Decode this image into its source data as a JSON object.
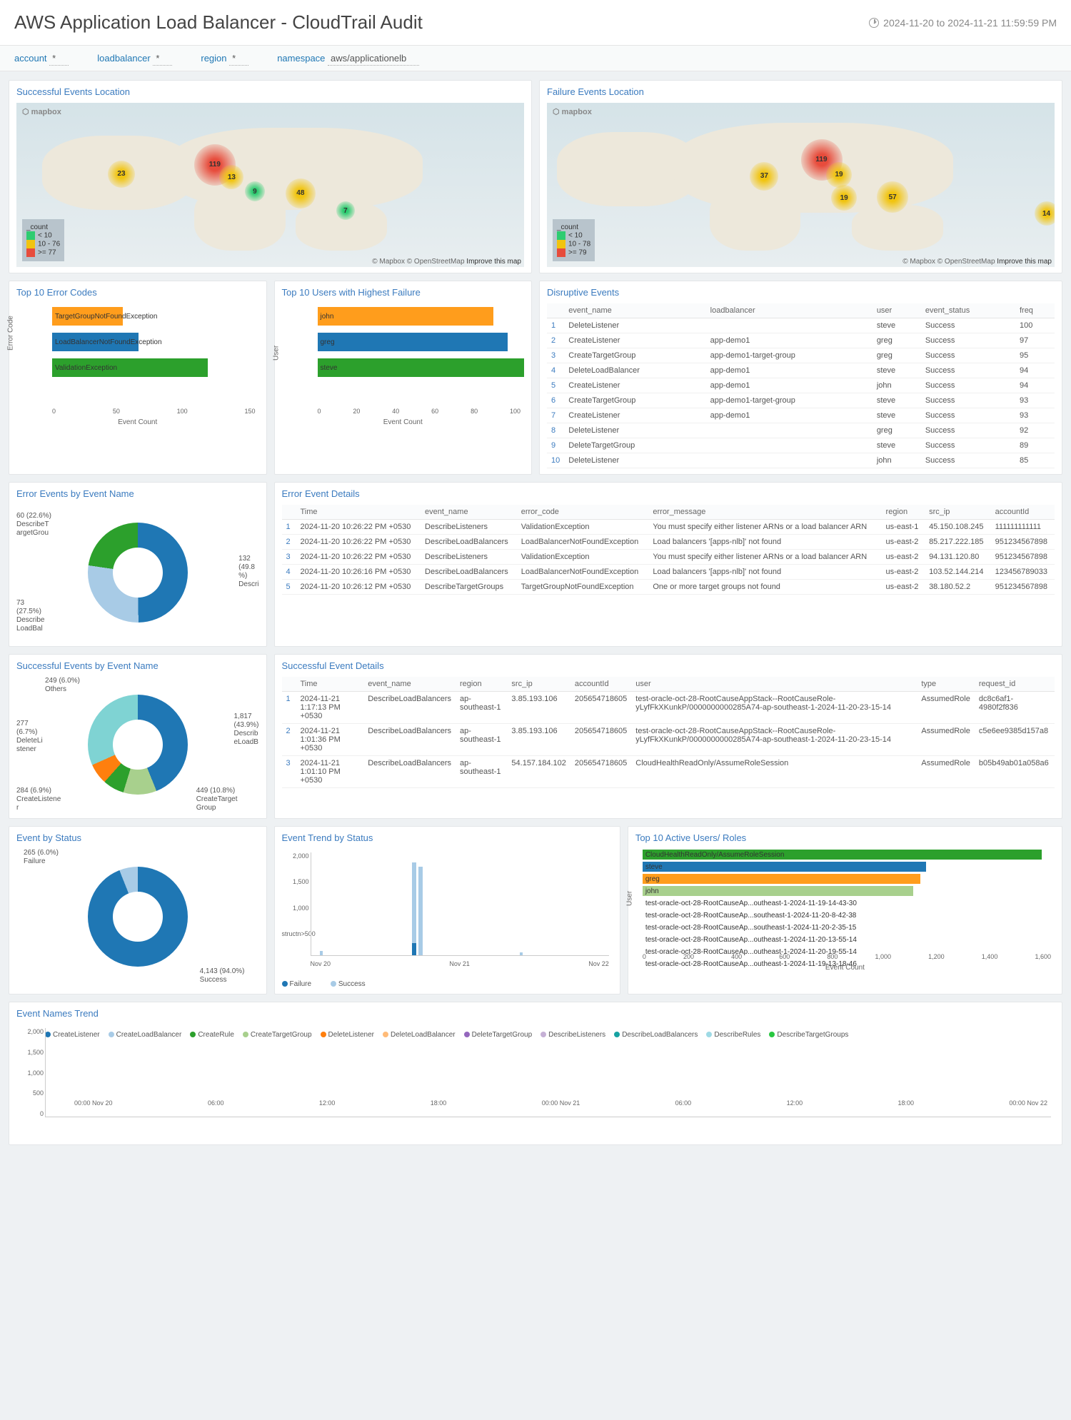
{
  "header": {
    "title": "AWS Application Load Balancer - CloudTrail Audit",
    "range": "2024-11-20 to 2024-11-21 11:59:59 PM"
  },
  "filters": [
    {
      "label": "account",
      "value": "*"
    },
    {
      "label": "loadbalancer",
      "value": "*"
    },
    {
      "label": "region",
      "value": "*"
    },
    {
      "label": "namespace",
      "value": "aws/applicationelb"
    }
  ],
  "maps": {
    "success": {
      "title": "Successful Events Location",
      "legend": {
        "title": "_count",
        "buckets": [
          "< 10",
          "10 - 76",
          ">= 77"
        ]
      },
      "attribution": "© Mapbox © OpenStreetMap",
      "improve": "Improve this map",
      "bubbles": [
        {
          "v": "119",
          "c": "red",
          "x": 35,
          "y": 25,
          "s": 58
        },
        {
          "v": "23",
          "c": "yel",
          "x": 18,
          "y": 35,
          "s": 38
        },
        {
          "v": "13",
          "c": "yel",
          "x": 40,
          "y": 38,
          "s": 34
        },
        {
          "v": "48",
          "c": "yel",
          "x": 53,
          "y": 46,
          "s": 42
        },
        {
          "v": "9",
          "c": "grn",
          "x": 45,
          "y": 48,
          "s": 28
        },
        {
          "v": "7",
          "c": "grn",
          "x": 63,
          "y": 60,
          "s": 26
        }
      ]
    },
    "failure": {
      "title": "Failure Events Location",
      "legend": {
        "title": "_count",
        "buckets": [
          "< 10",
          "10 - 78",
          ">= 79"
        ]
      },
      "attribution": "© Mapbox © OpenStreetMap",
      "improve": "Improve this map",
      "bubbles": [
        {
          "v": "119",
          "c": "red",
          "x": 50,
          "y": 22,
          "s": 58
        },
        {
          "v": "37",
          "c": "yel",
          "x": 40,
          "y": 36,
          "s": 40
        },
        {
          "v": "19",
          "c": "yel",
          "x": 55,
          "y": 36,
          "s": 36
        },
        {
          "v": "19",
          "c": "yel",
          "x": 56,
          "y": 50,
          "s": 36
        },
        {
          "v": "57",
          "c": "yel",
          "x": 65,
          "y": 48,
          "s": 44
        },
        {
          "v": "14",
          "c": "yel",
          "x": 96,
          "y": 60,
          "s": 34
        }
      ]
    }
  },
  "chart_data": {
    "top_error_codes": {
      "type": "bar",
      "title": "Top 10 Error Codes",
      "xlabel": "Event Count",
      "ylabel": "Error Code",
      "ylim": [
        0,
        175
      ],
      "categories": [
        "ValidationException",
        "LoadBalancerNotFoundException",
        "TargetGroupNotFoundException"
      ],
      "values": [
        132,
        73,
        60
      ],
      "colors": [
        "#2ca02c",
        "#1f77b4",
        "#ff9d1c"
      ]
    },
    "top_failure_users": {
      "type": "bar",
      "title": "Top 10 Users with Highest Failure",
      "xlabel": "Event Count",
      "ylabel": "User",
      "ylim": [
        0,
        100
      ],
      "categories": [
        "steve",
        "greg",
        "john"
      ],
      "values": [
        100,
        92,
        85
      ],
      "colors": [
        "#2ca02c",
        "#1f77b4",
        "#ff9d1c"
      ]
    },
    "error_events_by_name": {
      "type": "pie",
      "title": "Error Events by Event Name",
      "series": [
        {
          "name": "Descri",
          "value": 132,
          "pct": 49.8,
          "color": "#1f77b4"
        },
        {
          "name": "DescribeLoadBal",
          "value": 73,
          "pct": 27.5,
          "color": "#a8cbe6"
        },
        {
          "name": "DescribeTargetGrou",
          "value": 60,
          "pct": 22.6,
          "color": "#2ca02c"
        }
      ]
    },
    "success_events_by_name": {
      "type": "pie",
      "title": "Successful Events by Event Name",
      "series": [
        {
          "name": "DescribeLoadB",
          "value": 1817,
          "pct": 43.9,
          "color": "#1f77b4"
        },
        {
          "name": "CreateTargetGroup",
          "value": 449,
          "pct": 10.8,
          "color": "#a8d08d"
        },
        {
          "name": "CreateListener",
          "value": 284,
          "pct": 6.9,
          "color": "#2ca02c"
        },
        {
          "name": "DeleteListener",
          "value": 277,
          "pct": 6.7,
          "color": "#ff7f0e"
        },
        {
          "name": "Others",
          "value": 249,
          "pct": 6.0,
          "color": "#7fd3d3"
        }
      ]
    },
    "event_by_status": {
      "type": "pie",
      "title": "Event by Status",
      "series": [
        {
          "name": "Success",
          "value": 4143,
          "pct": 94.0,
          "color": "#1f77b4"
        },
        {
          "name": "Failure",
          "value": 265,
          "pct": 6.0,
          "color": "#a8cbe6"
        }
      ]
    },
    "event_trend": {
      "type": "line",
      "title": "Event Trend by Status",
      "xlabel": "",
      "ylabel": "",
      "ylim": [
        0,
        2000
      ],
      "x": [
        "Nov 20",
        "Nov 21",
        "Nov 22"
      ],
      "series": [
        {
          "name": "Failure",
          "color": "#1f77b4"
        },
        {
          "name": "Success",
          "color": "#a8cbe6"
        }
      ],
      "peak": {
        "x_frac": 0.35,
        "success": 1800,
        "failure": 250
      }
    },
    "active_users": {
      "type": "bar",
      "title": "Top 10 Active Users/ Roles",
      "xlabel": "Event Count",
      "ylabel": "User",
      "ylim": [
        0,
        1600
      ],
      "categories": [
        "CloudHealthReadOnly/AssumeRoleSession",
        "steve",
        "greg",
        "john",
        "test-oracle-oct-28-RootCauseAp...outheast-1-2024-11-19-14-43-30",
        "test-oracle-oct-28-RootCauseAp...southeast-1-2024-11-20-8-42-38",
        "test-oracle-oct-28-RootCauseAp...southeast-1-2024-11-20-2-35-15",
        "test-oracle-oct-28-RootCauseAp...outheast-1-2024-11-20-13-55-14",
        "test-oracle-oct-28-RootCauseAp...outheast-1-2024-11-20-19-55-14",
        "test-oracle-oct-28-RootCauseAp...outheast-1-2024-11-19-13-18-46"
      ],
      "values": [
        1550,
        1100,
        1080,
        1050,
        0,
        0,
        0,
        0,
        0,
        0
      ],
      "colors": [
        "#2ca02c",
        "#1f77b4",
        "#ff9d1c",
        "#a8d08d",
        "#fff",
        "#fff",
        "#fff",
        "#fff",
        "#fff",
        "#fff"
      ]
    },
    "event_names_trend": {
      "type": "bar",
      "title": "Event Names Trend",
      "ylim": [
        0,
        2000
      ],
      "x_ticks": [
        "00:00 Nov 20",
        "06:00",
        "12:00",
        "18:00",
        "00:00 Nov 21",
        "06:00",
        "12:00",
        "18:00",
        "00:00 Nov 22"
      ],
      "series": [
        "CreateListener",
        "CreateLoadBalancer",
        "CreateRule",
        "CreateTargetGroup",
        "DeleteListener",
        "DeleteLoadBalancer",
        "DeleteTargetGroup",
        "DescribeListeners",
        "DescribeLoadBalancers",
        "DescribeRules",
        "DescribeTargetGroups"
      ],
      "colors": [
        "#1f77b4",
        "#a8cbe6",
        "#2ca02c",
        "#a8d08d",
        "#ff7f0e",
        "#ffbb78",
        "#9467bd",
        "#c5b0d5",
        "#17a2a2",
        "#9edae5",
        "#28c740"
      ]
    }
  },
  "disruptive": {
    "title": "Disruptive Events",
    "headers": [
      "event_name",
      "loadbalancer",
      "user",
      "event_status",
      "freq"
    ],
    "rows": [
      [
        "DeleteListener",
        "",
        "steve",
        "Success",
        "100"
      ],
      [
        "CreateListener",
        "app-demo1",
        "greg",
        "Success",
        "97"
      ],
      [
        "CreateTargetGroup",
        "app-demo1-target-group",
        "greg",
        "Success",
        "95"
      ],
      [
        "DeleteLoadBalancer",
        "app-demo1",
        "steve",
        "Success",
        "94"
      ],
      [
        "CreateListener",
        "app-demo1",
        "john",
        "Success",
        "94"
      ],
      [
        "CreateTargetGroup",
        "app-demo1-target-group",
        "steve",
        "Success",
        "93"
      ],
      [
        "CreateListener",
        "app-demo1",
        "steve",
        "Success",
        "93"
      ],
      [
        "DeleteListener",
        "",
        "greg",
        "Success",
        "92"
      ],
      [
        "DeleteTargetGroup",
        "",
        "steve",
        "Success",
        "89"
      ],
      [
        "DeleteListener",
        "",
        "john",
        "Success",
        "85"
      ]
    ]
  },
  "error_details": {
    "title": "Error Event Details",
    "headers": [
      "Time",
      "event_name",
      "error_code",
      "error_message",
      "region",
      "src_ip",
      "accountId"
    ],
    "rows": [
      [
        "2024-11-20 10:26:22 PM +0530",
        "DescribeListeners",
        "ValidationException",
        "You must specify either listener ARNs or a load balancer ARN",
        "us-east-1",
        "45.150.108.245",
        "111111111111"
      ],
      [
        "2024-11-20 10:26:22 PM +0530",
        "DescribeLoadBalancers",
        "LoadBalancerNotFoundException",
        "Load balancers '[apps-nlb]' not found",
        "us-east-2",
        "85.217.222.185",
        "951234567898"
      ],
      [
        "2024-11-20 10:26:22 PM +0530",
        "DescribeListeners",
        "ValidationException",
        "You must specify either listener ARNs or a load balancer ARN",
        "us-east-2",
        "94.131.120.80",
        "951234567898"
      ],
      [
        "2024-11-20 10:26:16 PM +0530",
        "DescribeLoadBalancers",
        "LoadBalancerNotFoundException",
        "Load balancers '[apps-nlb]' not found",
        "us-east-2",
        "103.52.144.214",
        "123456789033"
      ],
      [
        "2024-11-20 10:26:12 PM +0530",
        "DescribeTargetGroups",
        "TargetGroupNotFoundException",
        "One or more target groups not found",
        "us-east-2",
        "38.180.52.2",
        "951234567898"
      ]
    ]
  },
  "success_details": {
    "title": "Successful Event Details",
    "headers": [
      "Time",
      "event_name",
      "region",
      "src_ip",
      "accountId",
      "user",
      "type",
      "request_id"
    ],
    "rows": [
      [
        "2024-11-21 1:17:13 PM +0530",
        "DescribeLoadBalancers",
        "ap-southeast-1",
        "3.85.193.106",
        "205654718605",
        "test-oracle-oct-28-RootCauseAppStack--RootCauseRole-yLyfFkXKunkP/0000000000285A74-ap-southeast-1-2024-11-20-23-15-14",
        "AssumedRole",
        "dc8c6af1-4980f2f836"
      ],
      [
        "2024-11-21 1:01:36 PM +0530",
        "DescribeLoadBalancers",
        "ap-southeast-1",
        "3.85.193.106",
        "205654718605",
        "test-oracle-oct-28-RootCauseAppStack--RootCauseRole-yLyfFkXKunkP/0000000000285A74-ap-southeast-1-2024-11-20-23-15-14",
        "AssumedRole",
        "c5e6ee9385d157a8"
      ],
      [
        "2024-11-21 1:01:10 PM +0530",
        "DescribeLoadBalancers",
        "ap-southeast-1",
        "54.157.184.102",
        "205654718605",
        "CloudHealthReadOnly/AssumeRoleSession",
        "AssumedRole",
        "b05b49ab01a058a6"
      ]
    ]
  }
}
